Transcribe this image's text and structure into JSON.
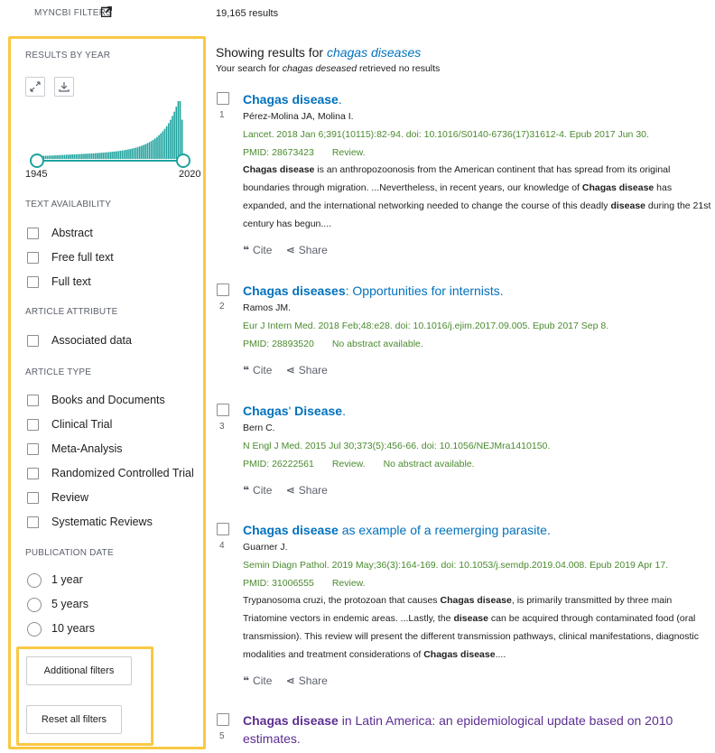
{
  "topbar": {
    "myncbi_label": "MYNCBI FILTERS",
    "results_count": "19,165 results"
  },
  "sidebar": {
    "results_by_year": {
      "header": "RESULTS BY YEAR",
      "start_year": "1945",
      "end_year": "2020",
      "histogram_color": "#20a39e"
    },
    "text_availability": {
      "header": "TEXT AVAILABILITY",
      "options": [
        "Abstract",
        "Free full text",
        "Full text"
      ]
    },
    "article_attribute": {
      "header": "ARTICLE ATTRIBUTE",
      "options": [
        "Associated data"
      ]
    },
    "article_type": {
      "header": "ARTICLE TYPE",
      "options": [
        "Books and Documents",
        "Clinical Trial",
        "Meta-Analysis",
        "Randomized Controlled Trial",
        "Review",
        "Systematic Reviews"
      ]
    },
    "publication_date": {
      "header": "PUBLICATION DATE",
      "options": [
        "1 year",
        "5 years",
        "10 years"
      ]
    },
    "additional_filters": "Additional filters",
    "reset_filters": "Reset all filters",
    "highlight_color": "#f9c844"
  },
  "main": {
    "showing_prefix": "Showing results for",
    "showing_term": "chagas diseases",
    "search_prefix": "Your search for",
    "search_term": "chagas deseased",
    "search_suffix": "retrieved no results",
    "cite_label": "Cite",
    "share_label": "Share",
    "articles": [
      {
        "num": "1",
        "title_bold": "Chagas disease",
        "title_rest": ".",
        "authors": "Pérez-Molina JA, Molina I.",
        "citation": "Lancet. 2018 Jan 6;391(10115):82-94. doi: 10.1016/S0140-6736(17)31612-4. Epub 2017 Jun 30.",
        "pmid": "PMID: 28673423",
        "tag": "Review.",
        "tag2": "",
        "snippet": [
          [
            "Chagas disease",
            true
          ],
          [
            " is an anthropozoonosis from the American continent that has spread from its original boundaries through migration. ...Nevertheless, in recent years, our knowledge of ",
            false
          ],
          [
            "Chagas disease",
            true
          ],
          [
            " has expanded, and the international networking needed to change the course of this deadly ",
            false
          ],
          [
            "disease",
            true
          ],
          [
            " during the 21st century has begun....",
            false
          ]
        ]
      },
      {
        "num": "2",
        "title_bold": "Chagas diseases",
        "title_rest": ": Opportunities for internists.",
        "authors": "Ramos JM.",
        "citation": "Eur J Intern Med. 2018 Feb;48:e28. doi: 10.1016/j.ejim.2017.09.005. Epub 2017 Sep 8.",
        "pmid": "PMID: 28893520",
        "tag": "No abstract available.",
        "tag2": "",
        "snippet": []
      },
      {
        "num": "3",
        "title_bold": "Chagas",
        "title_rest": "' ",
        "title_bold2": "Disease",
        "title_rest2": ".",
        "authors": "Bern C.",
        "citation": "N Engl J Med. 2015 Jul 30;373(5):456-66. doi: 10.1056/NEJMra1410150.",
        "pmid": "PMID: 26222561",
        "tag": "Review.",
        "tag2": "No abstract available.",
        "snippet": []
      },
      {
        "num": "4",
        "title_bold": "Chagas disease",
        "title_rest": " as example of a reemerging parasite.",
        "authors": "Guarner J.",
        "citation": "Semin Diagn Pathol. 2019 May;36(3):164-169. doi: 10.1053/j.semdp.2019.04.008. Epub 2019 Apr 17.",
        "pmid": "PMID: 31006555",
        "tag": "Review.",
        "tag2": "",
        "snippet": [
          [
            "Trypanosoma cruzi, the protozoan that causes ",
            false
          ],
          [
            "Chagas disease",
            true
          ],
          [
            ", is primarily transmitted by three main Triatomine vectors in endemic areas. ...Lastly, the ",
            false
          ],
          [
            "disease",
            true
          ],
          [
            " can be acquired through contaminated food (oral transmission). This review will present the different transmission pathways, clinical manifestations, diagnostic modalities and treatment considerations of ",
            false
          ],
          [
            "Chagas disease",
            true
          ],
          [
            "....",
            false
          ]
        ]
      },
      {
        "num": "5",
        "title_bold": "Chagas disease",
        "title_rest": " in Latin America: an epidemiological update based on 2010 estimates.",
        "authors": "",
        "citation": "",
        "pmid": "",
        "tag": "",
        "tag2": "",
        "snippet": []
      }
    ]
  }
}
